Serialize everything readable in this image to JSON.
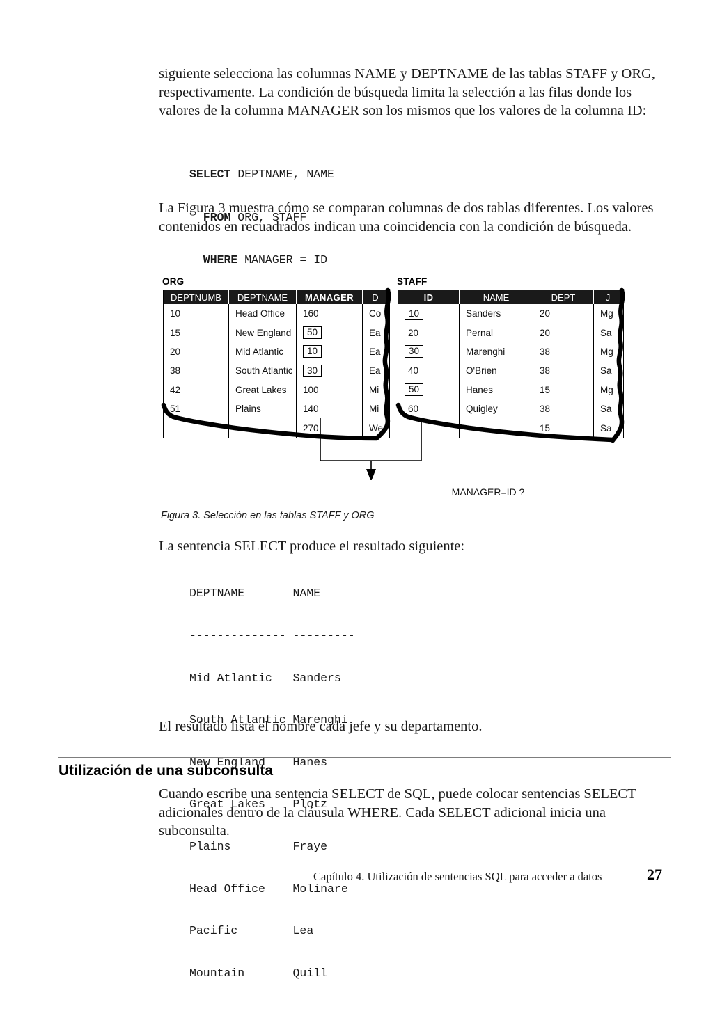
{
  "paragraphs": {
    "intro": "siguiente selecciona las columnas NAME y DEPTNAME de las tablas STAFF y ORG, respectivamente. La condición de búsqueda limita la selección a las filas donde los valores de la columna MANAGER son los mismos que los valores de la columna ID:",
    "figure_intro": "La Figura 3 muestra cómo se comparan columnas de dos tablas diferentes. Los valores contenidos en recuadrados indican una coincidencia con la condición de búsqueda.",
    "result_intro": "La sentencia SELECT produce el resultado siguiente:",
    "result_note": "El resultado lista el nombre cada jefe y su departamento.",
    "subquery_body": "Cuando escribe una sentencia SELECT de SQL, puede colocar sentencias SELECT adicionales dentro de la cláusula WHERE. Cada SELECT adicional inicia una subconsulta."
  },
  "sql_example": {
    "lines": [
      {
        "keyword": "SELECT",
        "rest": " DEPTNAME, NAME",
        "indent": 0
      },
      {
        "keyword": "FROM",
        "rest": " ORG, STAFF",
        "indent": 2
      },
      {
        "keyword": "WHERE",
        "rest": " MANAGER = ID",
        "indent": 2
      }
    ]
  },
  "result_listing": {
    "header": "DEPTNAME       NAME",
    "separator": "-------------- ---------",
    "rows": [
      "Mid Atlantic   Sanders",
      "South Atlantic Marenghi",
      "New England    Hanes",
      "Great Lakes    Plotz",
      "Plains         Fraye",
      "Head Office    Molinare",
      "Pacific        Lea",
      "Mountain       Quill"
    ]
  },
  "figure": {
    "caption": "Figura 3. Selección en las tablas STAFF y ORG",
    "match_label": "MANAGER=ID ?",
    "org": {
      "label": "ORG",
      "columns": [
        {
          "name": "DEPTNUMB",
          "bold": false
        },
        {
          "name": "DEPTNAME",
          "bold": false
        },
        {
          "name": "MANAGER",
          "bold": true
        },
        {
          "name": "D",
          "bold": false
        }
      ],
      "rows": [
        {
          "deptnumb": "10",
          "deptname": "Head Office",
          "manager": "160",
          "manager_boxed": false,
          "division": "Co"
        },
        {
          "deptnumb": "15",
          "deptname": "New England",
          "manager": "50",
          "manager_boxed": true,
          "division": "Ea"
        },
        {
          "deptnumb": "20",
          "deptname": "Mid Atlantic",
          "manager": "10",
          "manager_boxed": true,
          "division": "Ea"
        },
        {
          "deptnumb": "38",
          "deptname": "South Atlantic",
          "manager": "30",
          "manager_boxed": true,
          "division": "Ea"
        },
        {
          "deptnumb": "42",
          "deptname": "Great Lakes",
          "manager": "100",
          "manager_boxed": false,
          "division": "Mi"
        },
        {
          "deptnumb": "51",
          "deptname": "Plains",
          "manager": "140",
          "manager_boxed": false,
          "division": "Mi"
        },
        {
          "deptnumb": "",
          "deptname": "",
          "manager": "270",
          "manager_boxed": false,
          "division": "We"
        }
      ]
    },
    "staff": {
      "label": "STAFF",
      "columns": [
        {
          "name": "ID",
          "bold": true
        },
        {
          "name": "NAME",
          "bold": false
        },
        {
          "name": "DEPT",
          "bold": false
        },
        {
          "name": "J",
          "bold": false
        }
      ],
      "rows": [
        {
          "id": "10",
          "id_boxed": true,
          "name": "Sanders",
          "dept": "20",
          "job": "Mg"
        },
        {
          "id": "20",
          "id_boxed": false,
          "name": "Pernal",
          "dept": "20",
          "job": "Sa"
        },
        {
          "id": "30",
          "id_boxed": true,
          "name": "Marenghi",
          "dept": "38",
          "job": "Mg"
        },
        {
          "id": "40",
          "id_boxed": false,
          "name": "O'Brien",
          "dept": "38",
          "job": "Sa"
        },
        {
          "id": "50",
          "id_boxed": true,
          "name": "Hanes",
          "dept": "15",
          "job": "Mg"
        },
        {
          "id": "60",
          "id_boxed": false,
          "name": "Quigley",
          "dept": "38",
          "job": "Sa"
        },
        {
          "id": "",
          "id_boxed": false,
          "name": "",
          "dept": "15",
          "job": "Sa"
        }
      ]
    }
  },
  "section": {
    "heading": "Utilización de una subconsulta"
  },
  "footer": {
    "text": "Capítulo 4. Utilización de sentencias SQL para acceder a datos",
    "page": "27"
  },
  "colors": {
    "header_bg": "#1a1a1a",
    "header_fg": "#ffffff",
    "rule": "#7d7d7d",
    "ink": "#1a1a1a"
  }
}
